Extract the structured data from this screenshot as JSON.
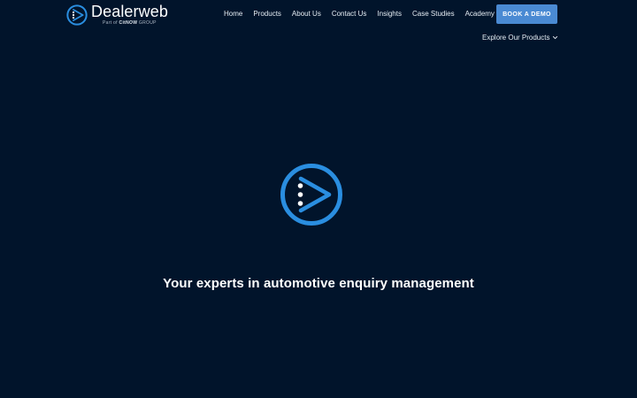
{
  "header": {
    "logo": {
      "name": "Dealerweb",
      "sub_prefix": "Part of ",
      "sub_brand": "CitNOW",
      "sub_suffix": " GROUP",
      "icon": "play-arrow-circle-icon"
    },
    "nav": [
      {
        "label": "Home"
      },
      {
        "label": "Products"
      },
      {
        "label": "About Us"
      },
      {
        "label": "Contact Us"
      },
      {
        "label": "Insights"
      },
      {
        "label": "Case Studies"
      },
      {
        "label": "Academy"
      }
    ],
    "cta_label": "BOOK A DEMO",
    "explore_label": "Explore Our Products",
    "explore_icon": "chevron-down-icon"
  },
  "hero": {
    "icon": "play-arrow-circle-icon",
    "tagline": "Your experts in automotive enquiry management"
  },
  "colors": {
    "background": "#01142b",
    "accent": "#2a8ee0",
    "button": "#4a8ad3",
    "text": "#ffffff"
  }
}
